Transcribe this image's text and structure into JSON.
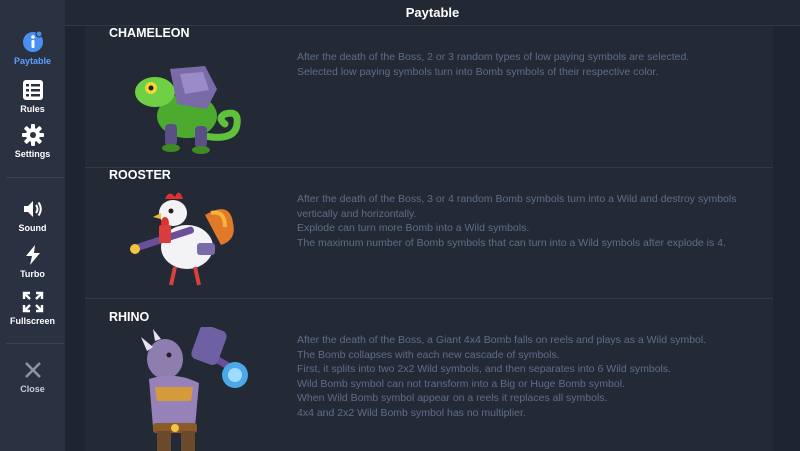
{
  "header": {
    "title": "Paytable"
  },
  "sidebar": {
    "items": [
      {
        "label": "Paytable",
        "icon": "info-icon",
        "active": true
      },
      {
        "label": "Rules",
        "icon": "list-icon"
      },
      {
        "label": "Settings",
        "icon": "gear-icon"
      },
      {
        "label": "Sound",
        "icon": "speaker-icon"
      },
      {
        "label": "Turbo",
        "icon": "lightning-icon"
      },
      {
        "label": "Fullscreen",
        "icon": "expand-icon"
      },
      {
        "label": "Close",
        "icon": "close-icon"
      }
    ]
  },
  "sections": [
    {
      "title": "CHAMELEON",
      "art": "chameleon-character",
      "description": "After the death of the Boss, 2 or 3 random types of low paying symbols are selected.\nSelected low paying symbols turn into Bomb symbols of their respective color."
    },
    {
      "title": "ROOSTER",
      "art": "rooster-character",
      "description": "After the death of the Boss, 3 or 4 random Bomb symbols turn into a Wild and destroy symbols vertically and horizontally.\nExplode can turn more Bomb into a Wild symbols.\nThe maximum number of Bomb symbols that can turn into a Wild symbols after explode is 4."
    },
    {
      "title": "RHINO",
      "art": "rhino-character",
      "description": "After the death of the Boss, a Giant 4x4 Bomb falls on reels and plays as a Wild symbol.\nThe Bomb collapses with each new cascade of symbols.\nFirst, it splits into two 2x2 Wild symbols, and then separates into 6 Wild symbols.\nWild Bomb symbol can not transform into a Big or Huge Bomb symbol.\nWhen Wild Bomb symbol appear on a reels it replaces all symbols.\n4x4 and 2x2 Wild Bomb symbol has no multiplier."
    }
  ],
  "colors": {
    "accent": "#5aa0ff",
    "sidebar_bg": "#2a3140",
    "panel_bg": "#232a36",
    "desc_text": "#5e6e86"
  }
}
